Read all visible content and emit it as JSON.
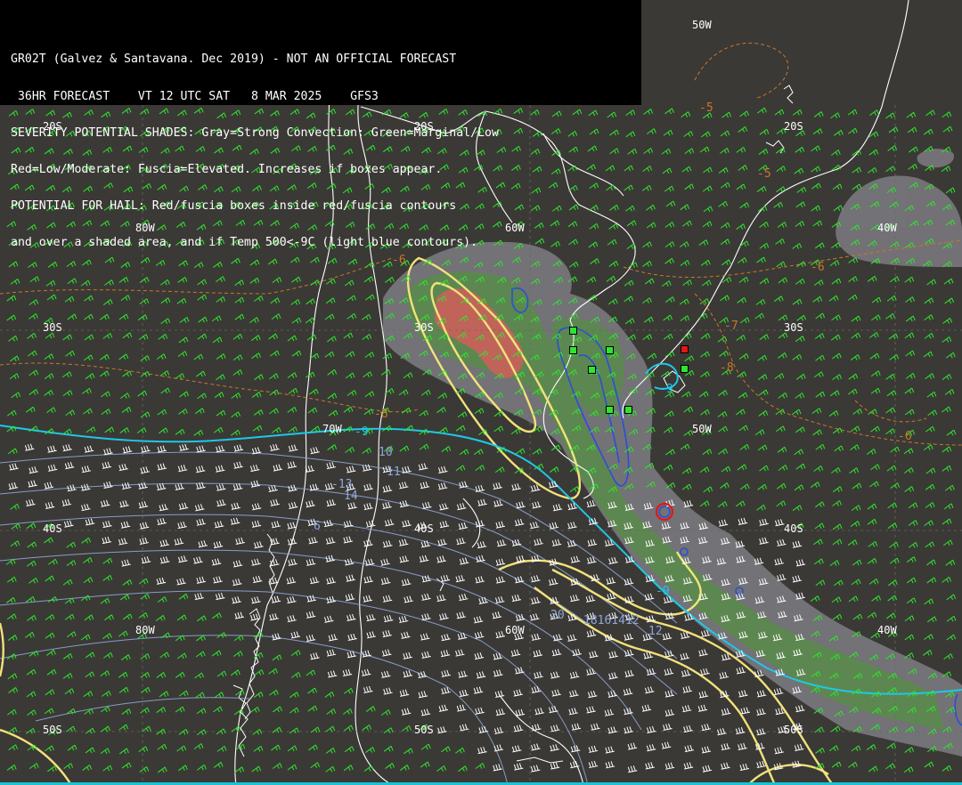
{
  "header": {
    "lines": [
      "GR02T (Galvez & Santavana. Dec 2019) - NOT AN OFFICIAL FORECAST",
      " 36HR FORECAST    VT 12 UTC SAT   8 MAR 2025    GFS3",
      "SEVERITY POTENTIAL SHADES: Gray=Strong Convection: Green=Marginal/Low",
      "Red=Low/Moderate: Fuscia=Elevated. Increases if boxes appear.",
      "POTENTIAL FOR HAIL: Red/fuscia boxes inside red/fuscia contours",
      "and over a shaded area, and if Temp 500<-9C (light blue contours)."
    ]
  },
  "grid_labels": {
    "lat_20s_a": "20S",
    "lat_20s_b": "20S",
    "lat_20s_c": "20S",
    "lon_50w_top": "50W",
    "lon_80w_a": "80W",
    "lon_60w_a": "60W",
    "lon_40w_a": "40W",
    "lat_30s_a": "30S",
    "lat_30s_b": "30S",
    "lat_30s_c": "30S",
    "lon_70w": "70W",
    "lon_50w_mid": "50W",
    "lat_40s_a": "40S",
    "lat_40s_b": "40S",
    "lat_40s_c": "40S",
    "lon_80w_b": "80W",
    "lon_60w_b": "60W",
    "lon_40w_b": "40W",
    "lat_50s_a": "50S",
    "lat_50s_b": "50S",
    "lat_50s_c": "50S"
  },
  "temp_labels": {
    "t_m5_a": "-5",
    "t_m5_b": "-5",
    "t_m6_a": "-6",
    "t_m6_b": "-6",
    "t_m6_c": "-6",
    "t_m7": "-7",
    "t_m8_a": "-8",
    "t_m8_b": "-8",
    "t_m9_a": "-9",
    "t_m9_b": "-9",
    "t_m9_c": "-9",
    "t_m10": "10",
    "t_m11": "11",
    "t_m13": "-13",
    "t_m14": "14",
    "t_m16": "6",
    "t_m20": "20",
    "t_row": "18161412",
    "t_12": "12"
  },
  "colors": {
    "background": "#3b3936",
    "coast": "#ffffff",
    "wind_barb": "#2ee62e",
    "wind_barb_strong": "#ffffff",
    "gray_shade": "#76757a",
    "green_shade": "#5b8a4d",
    "red_shade": "#c0645a",
    "yellow_contour": "#f2e27a",
    "cyan_contour": "#1ec8e6",
    "blue_contour": "#2850d6",
    "temp_contour": "#8fa7d9",
    "orange_label": "#c8782a",
    "marker_green": "#2ee62e",
    "marker_red": "#e01818"
  },
  "markers": [
    {
      "name": "marker-green-1",
      "color": "green"
    },
    {
      "name": "marker-green-2",
      "color": "green"
    },
    {
      "name": "marker-green-3",
      "color": "green"
    },
    {
      "name": "marker-green-4",
      "color": "green"
    },
    {
      "name": "marker-green-5",
      "color": "green"
    },
    {
      "name": "marker-green-6",
      "color": "green"
    },
    {
      "name": "marker-green-7",
      "color": "green"
    },
    {
      "name": "marker-red-1",
      "color": "red"
    },
    {
      "name": "marker-green-8",
      "color": "green"
    }
  ]
}
